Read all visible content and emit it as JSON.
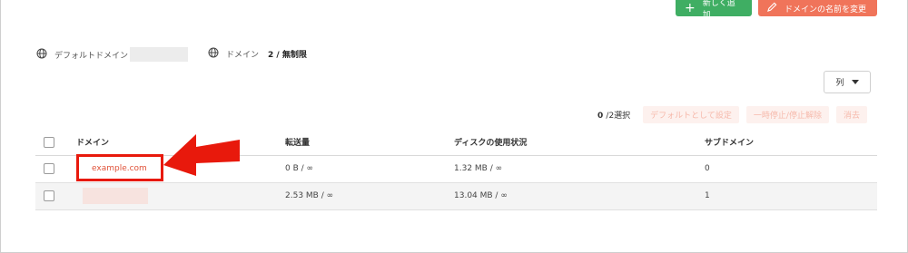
{
  "header": {
    "add_button_label": "新しく追加",
    "rename_button_label": "ドメインの名前を変更"
  },
  "info": {
    "default_domain_label": "デフォルトドメイン",
    "domain_label": "ドメイン",
    "domain_count": "2 / 無制限"
  },
  "columns_dropdown": {
    "label": "列"
  },
  "actions": {
    "selected_count": "0",
    "selected_suffix": "/2選択",
    "set_default": "デフォルトとして設定",
    "suspend_resume": "一時停止/停止解除",
    "delete": "消去"
  },
  "table": {
    "headers": {
      "domain": "ドメイン",
      "transfer": "転送量",
      "disk": "ディスクの使用状況",
      "subdomain": "サブドメイン"
    },
    "rows": [
      {
        "domain": "example.com",
        "transfer": "0 B / ∞",
        "disk": "1.32 MB / ∞",
        "subdomains": "0"
      },
      {
        "domain": "",
        "transfer": "2.53 MB / ∞",
        "disk": "13.04 MB / ∞",
        "subdomains": "1"
      }
    ]
  },
  "colors": {
    "green": "#3fae63",
    "orange": "#f0745a",
    "link": "#e0533a",
    "annotation_red": "#e8190c"
  },
  "icons": [
    "plus-icon",
    "pencil-icon",
    "globe-icon",
    "caret-down-icon",
    "annotation-arrow"
  ]
}
